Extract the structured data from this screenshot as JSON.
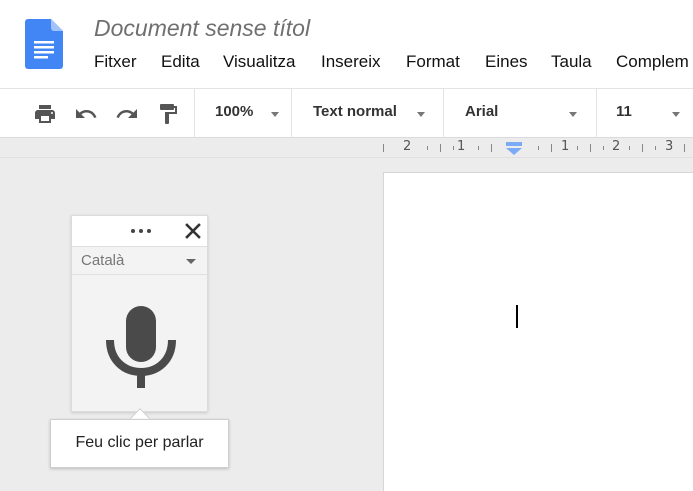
{
  "app": {
    "doc_title": "Document sense títol",
    "accent": "#4285f4"
  },
  "menu": {
    "items": [
      "Fitxer",
      "Edita",
      "Visualitza",
      "Insereix",
      "Format",
      "Eines",
      "Taula",
      "Complem"
    ]
  },
  "toolbar": {
    "icons": [
      "print-icon",
      "undo-icon",
      "redo-icon",
      "paint-format-icon"
    ],
    "zoom": "100%",
    "style": "Text normal",
    "font": "Arial",
    "size": "11"
  },
  "ruler": {
    "labels": [
      "2",
      "1",
      "1",
      "2",
      "3"
    ]
  },
  "voice_typing": {
    "language": "Català",
    "tooltip": "Feu clic per parlar"
  }
}
